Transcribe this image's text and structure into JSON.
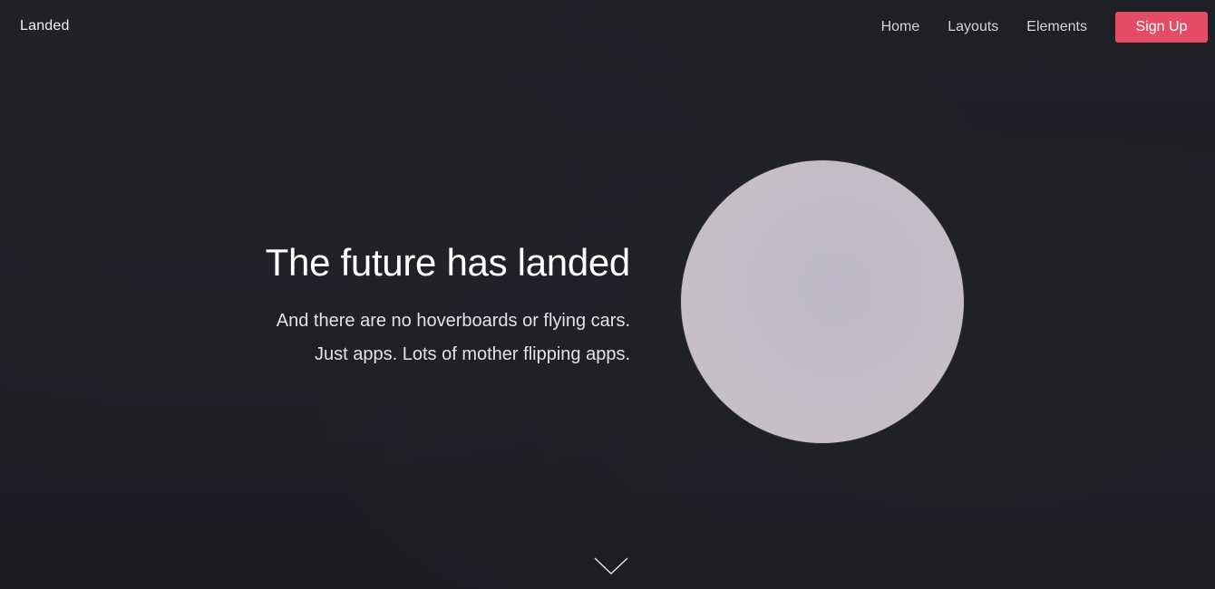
{
  "header": {
    "brand": "Landed",
    "nav": {
      "home": "Home",
      "layouts": "Layouts",
      "elements": "Elements",
      "signup": "Sign Up"
    }
  },
  "hero": {
    "title": "The future has landed",
    "subtitle_line1": "And there are no hoverboards or flying cars.",
    "subtitle_line2": "Just apps. Lots of mother flipping apps."
  },
  "colors": {
    "background": "#1f1f26",
    "accent": "#e44c65",
    "circle": "#c2bcc6"
  },
  "icons": {
    "scroll": "chevron-down-icon"
  }
}
